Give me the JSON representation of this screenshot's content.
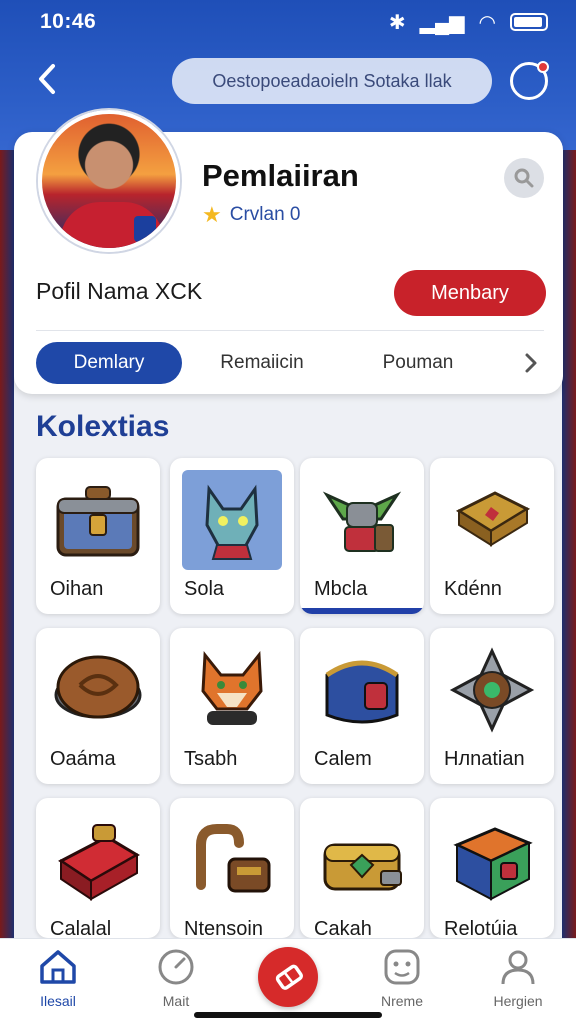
{
  "status": {
    "time": "10:46"
  },
  "header": {
    "back_icon": "chevron-left-icon",
    "search_placeholder": "Oestopoeadaoieln Sotaka llak",
    "notif_icon": "chat-bubble-icon"
  },
  "profile": {
    "name": "Pemlaiiran",
    "rank": "Crvlan 0",
    "label": "Pofil Nama XCK",
    "member_button": "Menbary"
  },
  "tabs": [
    {
      "label": "Demlary",
      "active": true
    },
    {
      "label": "Remaiicin",
      "active": false
    },
    {
      "label": "Pouman",
      "active": false
    }
  ],
  "section": {
    "title": "Kolextias"
  },
  "items": [
    {
      "label": "Oihan",
      "icon": "treasure-chest-icon"
    },
    {
      "label": "Sola",
      "icon": "wolf-icon"
    },
    {
      "label": "Mbcla",
      "icon": "goblin-warrior-icon",
      "selected": true
    },
    {
      "label": "Kdénn",
      "icon": "spellbook-icon"
    },
    {
      "label": "Oaáma",
      "icon": "bronze-shield-icon"
    },
    {
      "label": "Tsabh",
      "icon": "fox-icon"
    },
    {
      "label": "Calem",
      "icon": "armor-icon"
    },
    {
      "label": "Hлnatian",
      "icon": "spiked-gem-icon"
    },
    {
      "label": "Calalal",
      "icon": "red-chest-icon"
    },
    {
      "label": "Ntensoin",
      "icon": "gauntlet-icon"
    },
    {
      "label": "Cakah",
      "icon": "gold-chest-icon"
    },
    {
      "label": "Relotúia",
      "icon": "rainbow-chest-icon"
    }
  ],
  "bottom_nav": [
    {
      "label": "Ilesail",
      "icon": "home-icon",
      "active": true
    },
    {
      "label": "Mait",
      "icon": "clock-icon",
      "active": false
    },
    {
      "label": "",
      "icon": "ticket-icon",
      "active": false
    },
    {
      "label": "Nreme",
      "icon": "face-icon",
      "active": false
    },
    {
      "label": "Hergien",
      "icon": "person-icon",
      "active": false
    }
  ],
  "colors": {
    "accent": "#1f48a8",
    "cta": "#c8222a"
  }
}
